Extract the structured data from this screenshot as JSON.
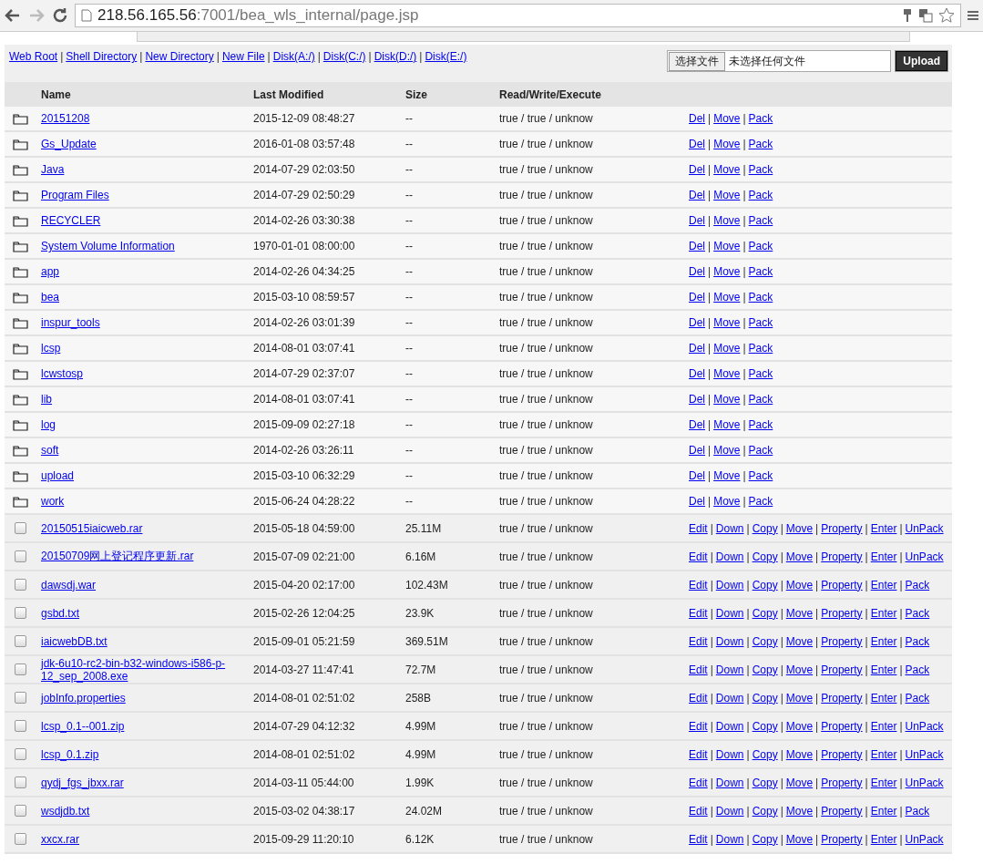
{
  "browser": {
    "url_host": "218.56.165.56",
    "url_rest": ":7001/bea_wls_internal/page.jsp"
  },
  "separator": "|",
  "nav_links": [
    "Web Root",
    "Shell Directory",
    "New Directory",
    "New File",
    "Disk(A:/)",
    "Disk(C:/)",
    "Disk(D:/)",
    "Disk(E:/)"
  ],
  "upload": {
    "choose_button": "选择文件",
    "file_status": "未选择任何文件",
    "button": "Upload"
  },
  "table": {
    "columns": [
      "Name",
      "Last Modified",
      "Size",
      "Read/Write/Execute"
    ],
    "rows": [
      {
        "kind": "folder",
        "name": "20151208",
        "modified": "2015-12-09 08:48:27",
        "size": "--",
        "rwx": "true / true / unknow",
        "actions": [
          "Del",
          "Move",
          "Pack"
        ]
      },
      {
        "kind": "folder",
        "name": "Gs_Update",
        "modified": "2016-01-08 03:57:48",
        "size": "--",
        "rwx": "true / true / unknow",
        "actions": [
          "Del",
          "Move",
          "Pack"
        ]
      },
      {
        "kind": "folder",
        "name": "Java",
        "modified": "2014-07-29 02:03:50",
        "size": "--",
        "rwx": "true / true / unknow",
        "actions": [
          "Del",
          "Move",
          "Pack"
        ]
      },
      {
        "kind": "folder",
        "name": "Program Files",
        "modified": "2014-07-29 02:50:29",
        "size": "--",
        "rwx": "true / true / unknow",
        "actions": [
          "Del",
          "Move",
          "Pack"
        ]
      },
      {
        "kind": "folder",
        "name": "RECYCLER",
        "modified": "2014-02-26 03:30:38",
        "size": "--",
        "rwx": "true / true / unknow",
        "actions": [
          "Del",
          "Move",
          "Pack"
        ]
      },
      {
        "kind": "folder",
        "name": "System Volume Information",
        "modified": "1970-01-01 08:00:00",
        "size": "--",
        "rwx": "true / true / unknow",
        "actions": [
          "Del",
          "Move",
          "Pack"
        ]
      },
      {
        "kind": "folder",
        "name": "app",
        "modified": "2014-02-26 04:34:25",
        "size": "--",
        "rwx": "true / true / unknow",
        "actions": [
          "Del",
          "Move",
          "Pack"
        ]
      },
      {
        "kind": "folder",
        "name": "bea",
        "modified": "2015-03-10 08:59:57",
        "size": "--",
        "rwx": "true / true / unknow",
        "actions": [
          "Del",
          "Move",
          "Pack"
        ]
      },
      {
        "kind": "folder",
        "name": "inspur_tools",
        "modified": "2014-02-26 03:01:39",
        "size": "--",
        "rwx": "true / true / unknow",
        "actions": [
          "Del",
          "Move",
          "Pack"
        ]
      },
      {
        "kind": "folder",
        "name": "lcsp",
        "modified": "2014-08-01 03:07:41",
        "size": "--",
        "rwx": "true / true / unknow",
        "actions": [
          "Del",
          "Move",
          "Pack"
        ]
      },
      {
        "kind": "folder",
        "name": "lcwstosp",
        "modified": "2014-07-29 02:37:07",
        "size": "--",
        "rwx": "true / true / unknow",
        "actions": [
          "Del",
          "Move",
          "Pack"
        ]
      },
      {
        "kind": "folder",
        "name": "lib",
        "modified": "2014-08-01 03:07:41",
        "size": "--",
        "rwx": "true / true / unknow",
        "actions": [
          "Del",
          "Move",
          "Pack"
        ]
      },
      {
        "kind": "folder",
        "name": "log",
        "modified": "2015-09-09 02:27:18",
        "size": "--",
        "rwx": "true / true / unknow",
        "actions": [
          "Del",
          "Move",
          "Pack"
        ]
      },
      {
        "kind": "folder",
        "name": "soft",
        "modified": "2014-02-26 03:26:11",
        "size": "--",
        "rwx": "true / true / unknow",
        "actions": [
          "Del",
          "Move",
          "Pack"
        ]
      },
      {
        "kind": "folder",
        "name": "upload",
        "modified": "2015-03-10 06:32:29",
        "size": "--",
        "rwx": "true / true / unknow",
        "actions": [
          "Del",
          "Move",
          "Pack"
        ]
      },
      {
        "kind": "folder",
        "name": "work",
        "modified": "2015-06-24 04:28:22",
        "size": "--",
        "rwx": "true / true / unknow",
        "actions": [
          "Del",
          "Move",
          "Pack"
        ]
      },
      {
        "kind": "file",
        "checked": false,
        "name": "20150515iaicweb.rar",
        "modified": "2015-05-18 04:59:00",
        "size": "25.11M",
        "rwx": "true / true / unknow",
        "actions": [
          "Edit",
          "Down",
          "Copy",
          "Move",
          "Property",
          "Enter",
          "UnPack"
        ]
      },
      {
        "kind": "file",
        "checked": false,
        "name": "20150709网上登记程序更新.rar",
        "modified": "2015-07-09 02:21:00",
        "size": "6.16M",
        "rwx": "true / true / unknow",
        "actions": [
          "Edit",
          "Down",
          "Copy",
          "Move",
          "Property",
          "Enter",
          "UnPack"
        ]
      },
      {
        "kind": "file",
        "checked": false,
        "name": "dawsdj.war",
        "modified": "2015-04-20 02:17:00",
        "size": "102.43M",
        "rwx": "true / true / unknow",
        "actions": [
          "Edit",
          "Down",
          "Copy",
          "Move",
          "Property",
          "Enter",
          "Pack"
        ]
      },
      {
        "kind": "file",
        "checked": false,
        "name": "gsbd.txt",
        "modified": "2015-02-26 12:04:25",
        "size": "23.9K",
        "rwx": "true / true / unknow",
        "actions": [
          "Edit",
          "Down",
          "Copy",
          "Move",
          "Property",
          "Enter",
          "Pack"
        ]
      },
      {
        "kind": "file",
        "checked": false,
        "name": "iaicwebDB.txt",
        "modified": "2015-09-01 05:21:59",
        "size": "369.51M",
        "rwx": "true / true / unknow",
        "actions": [
          "Edit",
          "Down",
          "Copy",
          "Move",
          "Property",
          "Enter",
          "Pack"
        ]
      },
      {
        "kind": "file",
        "checked": false,
        "name": "jdk-6u10-rc2-bin-b32-windows-i586-p-12_sep_2008.exe",
        "modified": "2014-03-27 11:47:41",
        "size": "72.7M",
        "rwx": "true / true / unknow",
        "actions": [
          "Edit",
          "Down",
          "Copy",
          "Move",
          "Property",
          "Enter",
          "Pack"
        ]
      },
      {
        "kind": "file",
        "checked": false,
        "name": "jobInfo.properties",
        "modified": "2014-08-01 02:51:02",
        "size": "258B",
        "rwx": "true / true / unknow",
        "actions": [
          "Edit",
          "Down",
          "Copy",
          "Move",
          "Property",
          "Enter",
          "Pack"
        ]
      },
      {
        "kind": "file",
        "checked": false,
        "name": "lcsp_0.1--001.zip",
        "modified": "2014-07-29 04:12:32",
        "size": "4.99M",
        "rwx": "true / true / unknow",
        "actions": [
          "Edit",
          "Down",
          "Copy",
          "Move",
          "Property",
          "Enter",
          "UnPack"
        ]
      },
      {
        "kind": "file",
        "checked": false,
        "name": "lcsp_0.1.zip",
        "modified": "2014-08-01 02:51:02",
        "size": "4.99M",
        "rwx": "true / true / unknow",
        "actions": [
          "Edit",
          "Down",
          "Copy",
          "Move",
          "Property",
          "Enter",
          "UnPack"
        ]
      },
      {
        "kind": "file",
        "checked": false,
        "name": "qydj_fgs_jbxx.rar",
        "modified": "2014-03-11 05:44:00",
        "size": "1.99K",
        "rwx": "true / true / unknow",
        "actions": [
          "Edit",
          "Down",
          "Copy",
          "Move",
          "Property",
          "Enter",
          "UnPack"
        ]
      },
      {
        "kind": "file",
        "checked": false,
        "name": "wsdjdb.txt",
        "modified": "2015-03-02 04:38:17",
        "size": "24.02M",
        "rwx": "true / true / unknow",
        "actions": [
          "Edit",
          "Down",
          "Copy",
          "Move",
          "Property",
          "Enter",
          "Pack"
        ]
      },
      {
        "kind": "file",
        "checked": false,
        "name": "xxcx.rar",
        "modified": "2015-09-29 11:20:10",
        "size": "6.12K",
        "rwx": "true / true / unknow",
        "actions": [
          "Edit",
          "Down",
          "Copy",
          "Move",
          "Property",
          "Enter",
          "UnPack"
        ]
      }
    ]
  }
}
